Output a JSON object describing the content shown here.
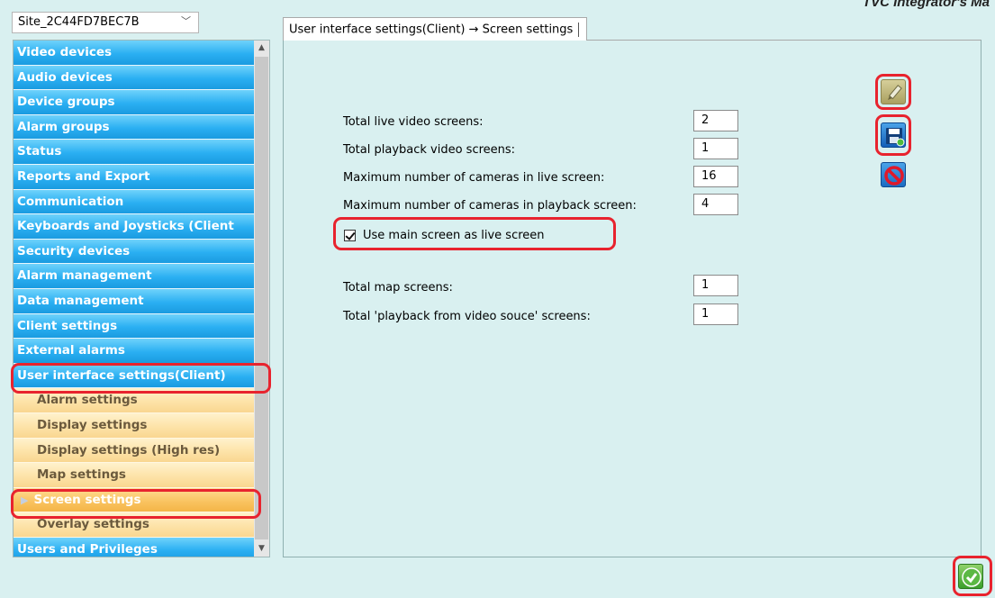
{
  "brand": {
    "text": "TVC Integrator's Ma"
  },
  "site_selector": {
    "value": "Site_2C44FD7BEC7B"
  },
  "sidebar": {
    "items": [
      {
        "label": "Video devices"
      },
      {
        "label": "Audio devices"
      },
      {
        "label": "Device groups"
      },
      {
        "label": "Alarm groups"
      },
      {
        "label": "Status"
      },
      {
        "label": "Reports and Export"
      },
      {
        "label": "Communication"
      },
      {
        "label": "Keyboards and Joysticks (Client"
      },
      {
        "label": "Security devices"
      },
      {
        "label": "Alarm management"
      },
      {
        "label": "Data management"
      },
      {
        "label": "Client settings"
      },
      {
        "label": "External alarms"
      },
      {
        "label": "User interface settings(Client)"
      }
    ],
    "sub_items": [
      {
        "label": "Alarm settings"
      },
      {
        "label": "Display settings"
      },
      {
        "label": "Display settings (High res)"
      },
      {
        "label": "Map settings"
      },
      {
        "label": "Screen settings"
      },
      {
        "label": "Overlay settings"
      }
    ],
    "next_item": {
      "label": "Users and Privileges"
    }
  },
  "tab": {
    "label": "User interface settings(Client) → Screen settings"
  },
  "settings": {
    "total_live": {
      "label": "Total live video screens:",
      "value": "2"
    },
    "total_playback": {
      "label": "Total playback video screens:",
      "value": "1"
    },
    "max_live_cams": {
      "label": "Maximum number of cameras in live screen:",
      "value": "16"
    },
    "max_playback_cams": {
      "label": "Maximum number of cameras in playback screen:",
      "value": "4"
    },
    "use_main_screen": {
      "label": "Use main screen as live screen",
      "checked": true
    },
    "total_map": {
      "label": "Total map  screens:",
      "value": "1"
    },
    "total_pb_source": {
      "label": "Total 'playback from video souce' screens:",
      "value": "1"
    }
  },
  "icons": {
    "edit": "pencil-icon",
    "save": "floppy-disk-icon",
    "cancel": "no-entry-icon",
    "confirm": "checkmark-icon"
  }
}
